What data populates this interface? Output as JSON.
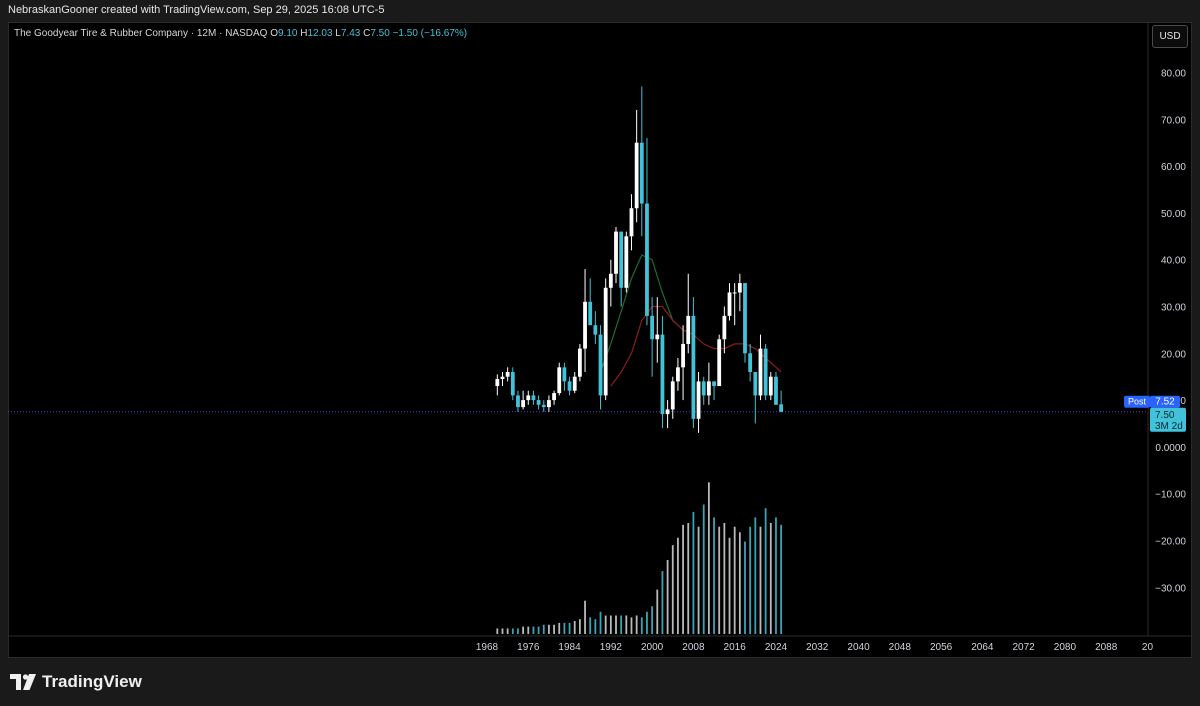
{
  "header": {
    "attribution": "NebraskanGooner created with TradingView.com, Sep 29, 2025 16:08 UTC-5"
  },
  "legend": {
    "symbol": "The Goodyear Tire & Rubber Company · 12M · NASDAQ",
    "open_label": "O",
    "open": "9.10",
    "high_label": "H",
    "high": "12.03",
    "low_label": "L",
    "low": "7.43",
    "close_label": "C",
    "close": "7.50",
    "change": "−1.50 (−16.67%)"
  },
  "currency_button": "USD",
  "price_tags": {
    "post_label": "Post",
    "post_value": "7.52",
    "last_value": "7.50",
    "countdown": "3M 2d"
  },
  "brand": "TradingView",
  "colors": {
    "background": "#000000",
    "bull": "#ffffff",
    "bear": "#41c2d8",
    "ma_fast": "#1e6b2e",
    "ma_slow": "#8c1c1c",
    "grid_text": "#d1d4dc",
    "accent": "#2962ff"
  },
  "chart_data": {
    "type": "candlestick",
    "interval": "12M",
    "y_axis": {
      "min": -40,
      "max": 85,
      "ticks": [
        "80.00",
        "70.00",
        "60.00",
        "50.00",
        "40.00",
        "30.00",
        "20.00",
        "10.00",
        "0.0000",
        "−10.00",
        "−20.00",
        "−30.00"
      ]
    },
    "x_axis": {
      "range": [
        1966,
        2100
      ],
      "ticks": [
        "1968",
        "1976",
        "1984",
        "1992",
        "2000",
        "2008",
        "2016",
        "2024",
        "2032",
        "2040",
        "2048",
        "2056",
        "2064",
        "2072",
        "2080",
        "2088",
        "20"
      ]
    },
    "ohlc": [
      [
        1970,
        13,
        15.5,
        11,
        14.5
      ],
      [
        1971,
        14.5,
        16,
        13,
        15
      ],
      [
        1972,
        15,
        17,
        14,
        16
      ],
      [
        1973,
        16,
        17,
        10,
        11
      ],
      [
        1974,
        11,
        12,
        7.5,
        8.5
      ],
      [
        1975,
        8.5,
        12,
        8,
        10
      ],
      [
        1976,
        10,
        12,
        9,
        11
      ],
      [
        1977,
        11,
        12,
        9,
        10
      ],
      [
        1978,
        10,
        11,
        8,
        9
      ],
      [
        1979,
        9,
        10,
        7.5,
        8.5
      ],
      [
        1980,
        8.5,
        11,
        7.5,
        10
      ],
      [
        1981,
        10,
        12,
        9,
        11.5
      ],
      [
        1982,
        11.5,
        18,
        11,
        17
      ],
      [
        1983,
        17,
        18,
        12,
        14
      ],
      [
        1984,
        14,
        15,
        11,
        12
      ],
      [
        1985,
        12,
        16,
        11.5,
        15
      ],
      [
        1986,
        15,
        22,
        14,
        21
      ],
      [
        1987,
        21,
        38,
        16,
        31
      ],
      [
        1988,
        31,
        36,
        27,
        26
      ],
      [
        1989,
        26,
        29,
        22,
        24
      ],
      [
        1990,
        24,
        26,
        8,
        11
      ],
      [
        1991,
        11,
        36,
        10,
        34
      ],
      [
        1992,
        34,
        40,
        30,
        37
      ],
      [
        1993,
        37,
        47,
        35,
        46
      ],
      [
        1994,
        46,
        46,
        30,
        34
      ],
      [
        1995,
        34,
        46,
        33,
        45
      ],
      [
        1996,
        45,
        54,
        42,
        51
      ],
      [
        1997,
        51,
        72,
        48,
        65
      ],
      [
        1998,
        65,
        77,
        45,
        52
      ],
      [
        1999,
        52,
        66,
        26,
        28
      ],
      [
        2000,
        28,
        32,
        15,
        23
      ],
      [
        2001,
        23,
        32,
        18,
        24
      ],
      [
        2002,
        24,
        28,
        4,
        7
      ],
      [
        2003,
        7,
        10,
        4,
        8
      ],
      [
        2004,
        8,
        15,
        6,
        14
      ],
      [
        2005,
        14,
        19,
        12,
        17
      ],
      [
        2006,
        17,
        26,
        10,
        22
      ],
      [
        2007,
        22,
        37,
        20,
        28
      ],
      [
        2008,
        28,
        32,
        4,
        6
      ],
      [
        2009,
        6,
        16,
        3,
        14
      ],
      [
        2010,
        14,
        15,
        9,
        11
      ],
      [
        2011,
        11,
        18,
        9,
        14
      ],
      [
        2012,
        14,
        14,
        10,
        13
      ],
      [
        2013,
        13,
        24,
        13,
        23
      ],
      [
        2014,
        23,
        30,
        20,
        28
      ],
      [
        2015,
        28,
        35,
        27,
        33
      ],
      [
        2016,
        33,
        35,
        26,
        33
      ],
      [
        2017,
        33,
        37,
        29,
        35
      ],
      [
        2018,
        35,
        35,
        18,
        20
      ],
      [
        2019,
        20,
        22,
        14,
        16
      ],
      [
        2020,
        16,
        16,
        5,
        11
      ],
      [
        2021,
        11,
        24,
        10,
        21
      ],
      [
        2022,
        21,
        22,
        10,
        11
      ],
      [
        2023,
        11,
        16,
        10,
        15
      ],
      [
        2024,
        15,
        16,
        9,
        9
      ],
      [
        2025,
        9.1,
        12.03,
        7.43,
        7.5
      ]
    ],
    "moving_averages": [
      {
        "points": [
          [
            1990,
            16
          ],
          [
            1992,
            22
          ],
          [
            1994,
            29
          ],
          [
            1996,
            36
          ],
          [
            1998,
            41
          ],
          [
            2000,
            40
          ],
          [
            2002,
            33
          ],
          [
            2004,
            27
          ],
          [
            2006,
            25
          ]
        ]
      },
      {
        "points": [
          [
            1992,
            13
          ],
          [
            1994,
            16
          ],
          [
            1996,
            20
          ],
          [
            1998,
            27
          ],
          [
            2000,
            30
          ],
          [
            2002,
            30
          ],
          [
            2004,
            27
          ],
          [
            2006,
            25
          ],
          [
            2008,
            24
          ],
          [
            2010,
            22
          ],
          [
            2012,
            21
          ],
          [
            2014,
            21
          ],
          [
            2016,
            22
          ],
          [
            2018,
            22
          ],
          [
            2020,
            21
          ],
          [
            2022,
            19
          ],
          [
            2024,
            17
          ],
          [
            2025,
            16
          ]
        ]
      }
    ],
    "current_price_line": 7.5,
    "volume": [
      [
        1970,
        3
      ],
      [
        1971,
        3
      ],
      [
        1972,
        3
      ],
      [
        1973,
        3
      ],
      [
        1974,
        3
      ],
      [
        1975,
        4
      ],
      [
        1976,
        4
      ],
      [
        1977,
        4
      ],
      [
        1978,
        4
      ],
      [
        1979,
        5
      ],
      [
        1980,
        5
      ],
      [
        1981,
        5
      ],
      [
        1982,
        6
      ],
      [
        1983,
        6
      ],
      [
        1984,
        6
      ],
      [
        1985,
        7
      ],
      [
        1986,
        8
      ],
      [
        1987,
        18
      ],
      [
        1988,
        9
      ],
      [
        1989,
        8
      ],
      [
        1990,
        12
      ],
      [
        1991,
        10
      ],
      [
        1992,
        10
      ],
      [
        1993,
        10
      ],
      [
        1994,
        10
      ],
      [
        1995,
        10
      ],
      [
        1996,
        9
      ],
      [
        1997,
        10
      ],
      [
        1998,
        9
      ],
      [
        1999,
        12
      ],
      [
        2000,
        15
      ],
      [
        2001,
        24
      ],
      [
        2002,
        34
      ],
      [
        2003,
        40
      ],
      [
        2004,
        48
      ],
      [
        2005,
        52
      ],
      [
        2006,
        59
      ],
      [
        2007,
        60
      ],
      [
        2008,
        66
      ],
      [
        2009,
        58
      ],
      [
        2010,
        70
      ],
      [
        2011,
        82
      ],
      [
        2012,
        63
      ],
      [
        2013,
        58
      ],
      [
        2014,
        60
      ],
      [
        2015,
        52
      ],
      [
        2016,
        58
      ],
      [
        2017,
        55
      ],
      [
        2018,
        50
      ],
      [
        2019,
        58
      ],
      [
        2020,
        63
      ],
      [
        2021,
        58
      ],
      [
        2022,
        68
      ],
      [
        2023,
        60
      ],
      [
        2024,
        63
      ],
      [
        2025,
        59
      ]
    ]
  }
}
